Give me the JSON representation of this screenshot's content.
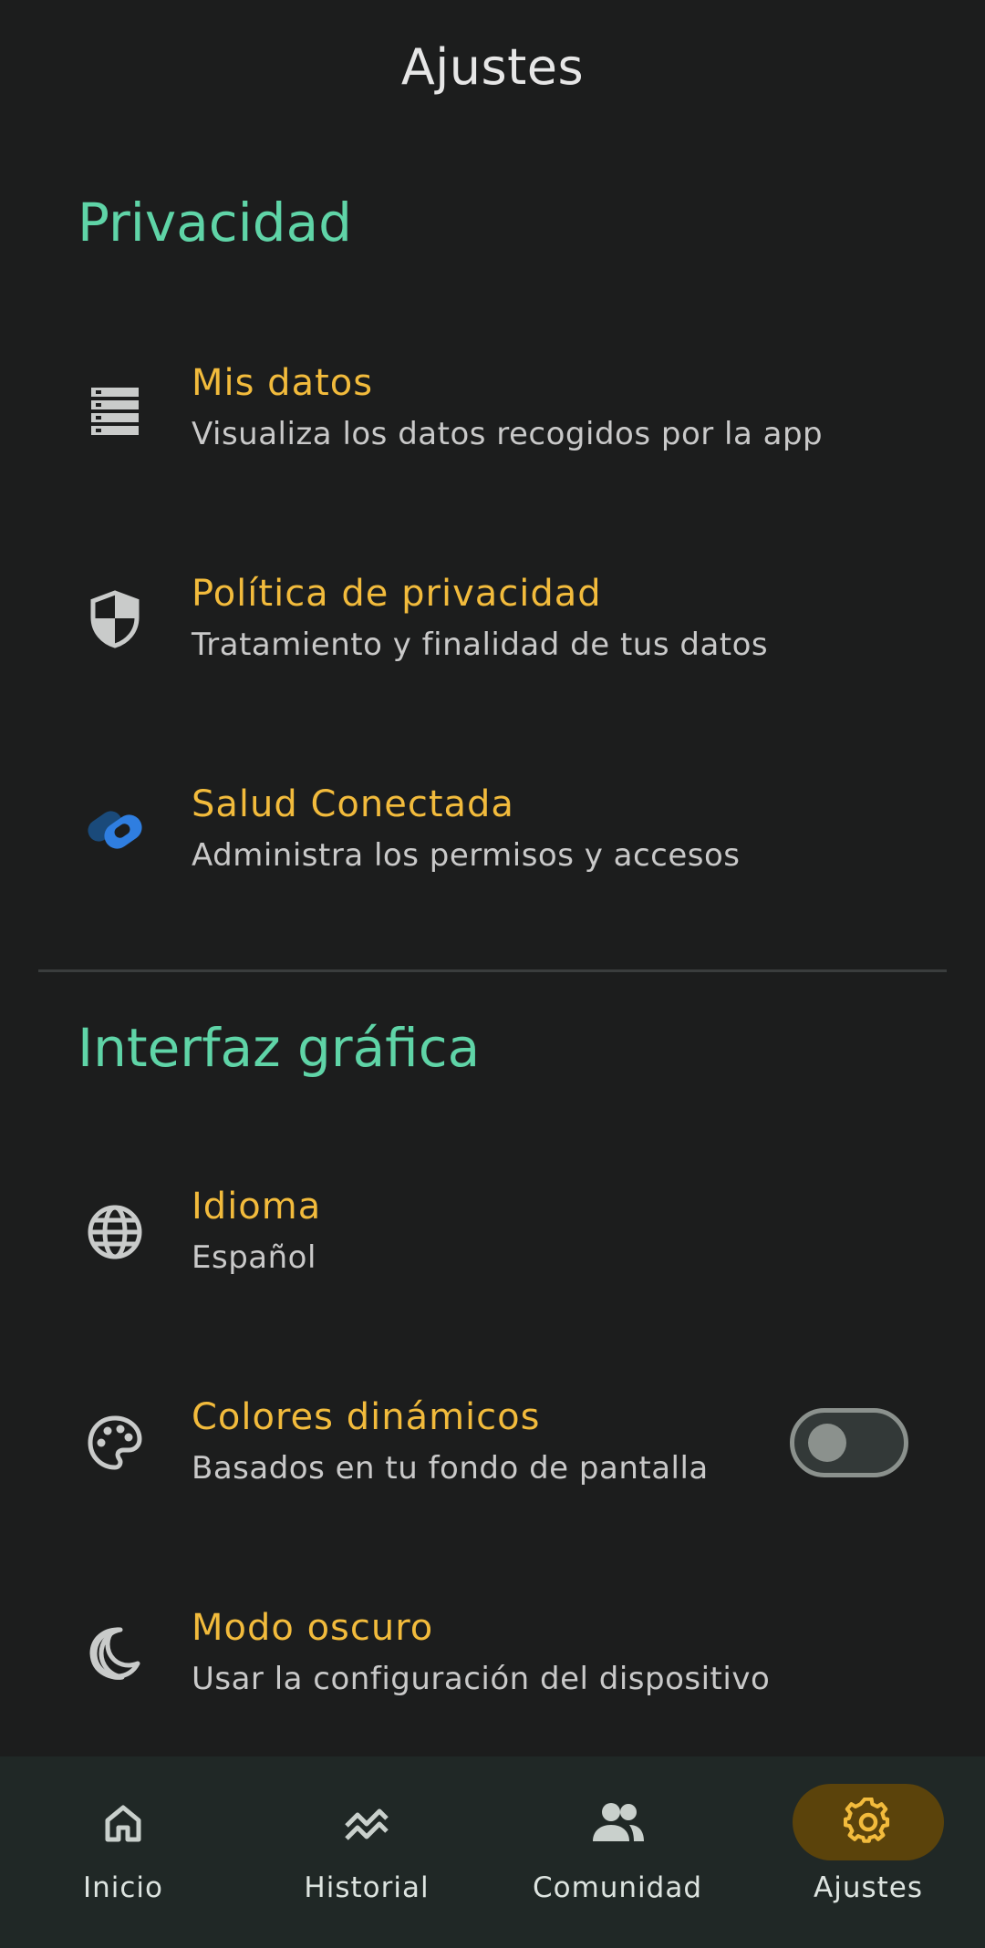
{
  "header": {
    "title": "Ajustes"
  },
  "sections": {
    "privacy": {
      "title": "Privacidad",
      "items": [
        {
          "title": "Mis datos",
          "subtitle": "Visualiza los datos recogidos por la app",
          "icon": "storage-icon"
        },
        {
          "title": "Política de privacidad",
          "subtitle": "Tratamiento y finalidad de tus datos",
          "icon": "shield-icon"
        },
        {
          "title": "Salud Conectada",
          "subtitle": "Administra los permisos y accesos",
          "icon": "health-connect-icon"
        }
      ]
    },
    "interface": {
      "title": "Interfaz gráfica",
      "items": [
        {
          "title": "Idioma",
          "subtitle": "Español",
          "icon": "globe-icon"
        },
        {
          "title": "Colores dinámicos",
          "subtitle": "Basados en tu fondo de pantalla",
          "icon": "palette-icon",
          "toggle": false
        },
        {
          "title": "Modo oscuro",
          "subtitle": "Usar la configuración del dispositivo",
          "icon": "moon-icon"
        }
      ]
    }
  },
  "bottom_nav": {
    "items": [
      {
        "label": "Inicio",
        "icon": "home-icon",
        "active": false
      },
      {
        "label": "Historial",
        "icon": "history-icon",
        "active": false
      },
      {
        "label": "Comunidad",
        "icon": "people-icon",
        "active": false
      },
      {
        "label": "Ajustes",
        "icon": "gear-icon",
        "active": true
      }
    ]
  },
  "colors": {
    "background": "#1c1d1d",
    "section_title": "#5fd4a7",
    "item_title": "#f2bb3c",
    "subtitle": "#c9c9c9",
    "nav_background": "#202826",
    "nav_active_pill": "#5b430b"
  }
}
